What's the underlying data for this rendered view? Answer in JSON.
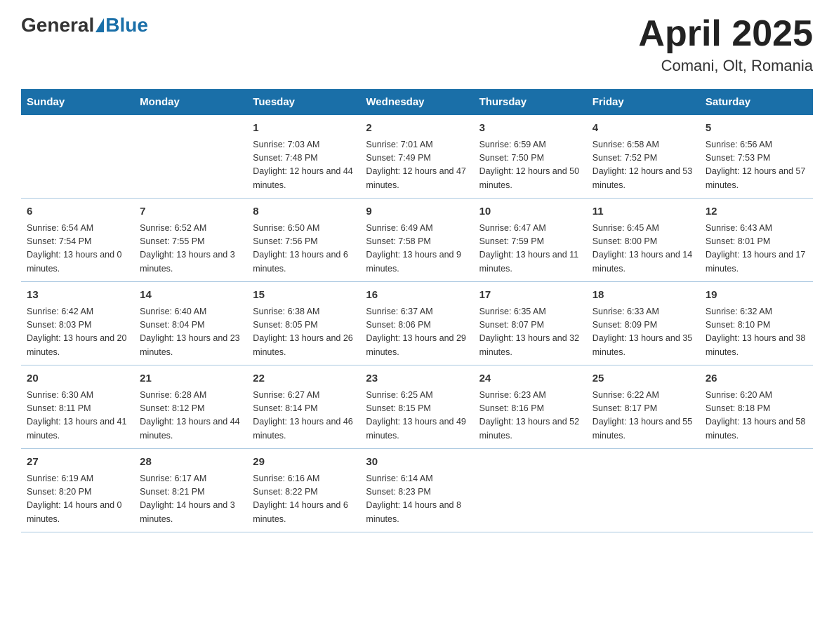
{
  "header": {
    "logo_general": "General",
    "logo_blue": "Blue",
    "title": "April 2025",
    "subtitle": "Comani, Olt, Romania"
  },
  "days_of_week": [
    "Sunday",
    "Monday",
    "Tuesday",
    "Wednesday",
    "Thursday",
    "Friday",
    "Saturday"
  ],
  "weeks": [
    [
      {
        "day": "",
        "sunrise": "",
        "sunset": "",
        "daylight": ""
      },
      {
        "day": "",
        "sunrise": "",
        "sunset": "",
        "daylight": ""
      },
      {
        "day": "1",
        "sunrise": "Sunrise: 7:03 AM",
        "sunset": "Sunset: 7:48 PM",
        "daylight": "Daylight: 12 hours and 44 minutes."
      },
      {
        "day": "2",
        "sunrise": "Sunrise: 7:01 AM",
        "sunset": "Sunset: 7:49 PM",
        "daylight": "Daylight: 12 hours and 47 minutes."
      },
      {
        "day": "3",
        "sunrise": "Sunrise: 6:59 AM",
        "sunset": "Sunset: 7:50 PM",
        "daylight": "Daylight: 12 hours and 50 minutes."
      },
      {
        "day": "4",
        "sunrise": "Sunrise: 6:58 AM",
        "sunset": "Sunset: 7:52 PM",
        "daylight": "Daylight: 12 hours and 53 minutes."
      },
      {
        "day": "5",
        "sunrise": "Sunrise: 6:56 AM",
        "sunset": "Sunset: 7:53 PM",
        "daylight": "Daylight: 12 hours and 57 minutes."
      }
    ],
    [
      {
        "day": "6",
        "sunrise": "Sunrise: 6:54 AM",
        "sunset": "Sunset: 7:54 PM",
        "daylight": "Daylight: 13 hours and 0 minutes."
      },
      {
        "day": "7",
        "sunrise": "Sunrise: 6:52 AM",
        "sunset": "Sunset: 7:55 PM",
        "daylight": "Daylight: 13 hours and 3 minutes."
      },
      {
        "day": "8",
        "sunrise": "Sunrise: 6:50 AM",
        "sunset": "Sunset: 7:56 PM",
        "daylight": "Daylight: 13 hours and 6 minutes."
      },
      {
        "day": "9",
        "sunrise": "Sunrise: 6:49 AM",
        "sunset": "Sunset: 7:58 PM",
        "daylight": "Daylight: 13 hours and 9 minutes."
      },
      {
        "day": "10",
        "sunrise": "Sunrise: 6:47 AM",
        "sunset": "Sunset: 7:59 PM",
        "daylight": "Daylight: 13 hours and 11 minutes."
      },
      {
        "day": "11",
        "sunrise": "Sunrise: 6:45 AM",
        "sunset": "Sunset: 8:00 PM",
        "daylight": "Daylight: 13 hours and 14 minutes."
      },
      {
        "day": "12",
        "sunrise": "Sunrise: 6:43 AM",
        "sunset": "Sunset: 8:01 PM",
        "daylight": "Daylight: 13 hours and 17 minutes."
      }
    ],
    [
      {
        "day": "13",
        "sunrise": "Sunrise: 6:42 AM",
        "sunset": "Sunset: 8:03 PM",
        "daylight": "Daylight: 13 hours and 20 minutes."
      },
      {
        "day": "14",
        "sunrise": "Sunrise: 6:40 AM",
        "sunset": "Sunset: 8:04 PM",
        "daylight": "Daylight: 13 hours and 23 minutes."
      },
      {
        "day": "15",
        "sunrise": "Sunrise: 6:38 AM",
        "sunset": "Sunset: 8:05 PM",
        "daylight": "Daylight: 13 hours and 26 minutes."
      },
      {
        "day": "16",
        "sunrise": "Sunrise: 6:37 AM",
        "sunset": "Sunset: 8:06 PM",
        "daylight": "Daylight: 13 hours and 29 minutes."
      },
      {
        "day": "17",
        "sunrise": "Sunrise: 6:35 AM",
        "sunset": "Sunset: 8:07 PM",
        "daylight": "Daylight: 13 hours and 32 minutes."
      },
      {
        "day": "18",
        "sunrise": "Sunrise: 6:33 AM",
        "sunset": "Sunset: 8:09 PM",
        "daylight": "Daylight: 13 hours and 35 minutes."
      },
      {
        "day": "19",
        "sunrise": "Sunrise: 6:32 AM",
        "sunset": "Sunset: 8:10 PM",
        "daylight": "Daylight: 13 hours and 38 minutes."
      }
    ],
    [
      {
        "day": "20",
        "sunrise": "Sunrise: 6:30 AM",
        "sunset": "Sunset: 8:11 PM",
        "daylight": "Daylight: 13 hours and 41 minutes."
      },
      {
        "day": "21",
        "sunrise": "Sunrise: 6:28 AM",
        "sunset": "Sunset: 8:12 PM",
        "daylight": "Daylight: 13 hours and 44 minutes."
      },
      {
        "day": "22",
        "sunrise": "Sunrise: 6:27 AM",
        "sunset": "Sunset: 8:14 PM",
        "daylight": "Daylight: 13 hours and 46 minutes."
      },
      {
        "day": "23",
        "sunrise": "Sunrise: 6:25 AM",
        "sunset": "Sunset: 8:15 PM",
        "daylight": "Daylight: 13 hours and 49 minutes."
      },
      {
        "day": "24",
        "sunrise": "Sunrise: 6:23 AM",
        "sunset": "Sunset: 8:16 PM",
        "daylight": "Daylight: 13 hours and 52 minutes."
      },
      {
        "day": "25",
        "sunrise": "Sunrise: 6:22 AM",
        "sunset": "Sunset: 8:17 PM",
        "daylight": "Daylight: 13 hours and 55 minutes."
      },
      {
        "day": "26",
        "sunrise": "Sunrise: 6:20 AM",
        "sunset": "Sunset: 8:18 PM",
        "daylight": "Daylight: 13 hours and 58 minutes."
      }
    ],
    [
      {
        "day": "27",
        "sunrise": "Sunrise: 6:19 AM",
        "sunset": "Sunset: 8:20 PM",
        "daylight": "Daylight: 14 hours and 0 minutes."
      },
      {
        "day": "28",
        "sunrise": "Sunrise: 6:17 AM",
        "sunset": "Sunset: 8:21 PM",
        "daylight": "Daylight: 14 hours and 3 minutes."
      },
      {
        "day": "29",
        "sunrise": "Sunrise: 6:16 AM",
        "sunset": "Sunset: 8:22 PM",
        "daylight": "Daylight: 14 hours and 6 minutes."
      },
      {
        "day": "30",
        "sunrise": "Sunrise: 6:14 AM",
        "sunset": "Sunset: 8:23 PM",
        "daylight": "Daylight: 14 hours and 8 minutes."
      },
      {
        "day": "",
        "sunrise": "",
        "sunset": "",
        "daylight": ""
      },
      {
        "day": "",
        "sunrise": "",
        "sunset": "",
        "daylight": ""
      },
      {
        "day": "",
        "sunrise": "",
        "sunset": "",
        "daylight": ""
      }
    ]
  ]
}
